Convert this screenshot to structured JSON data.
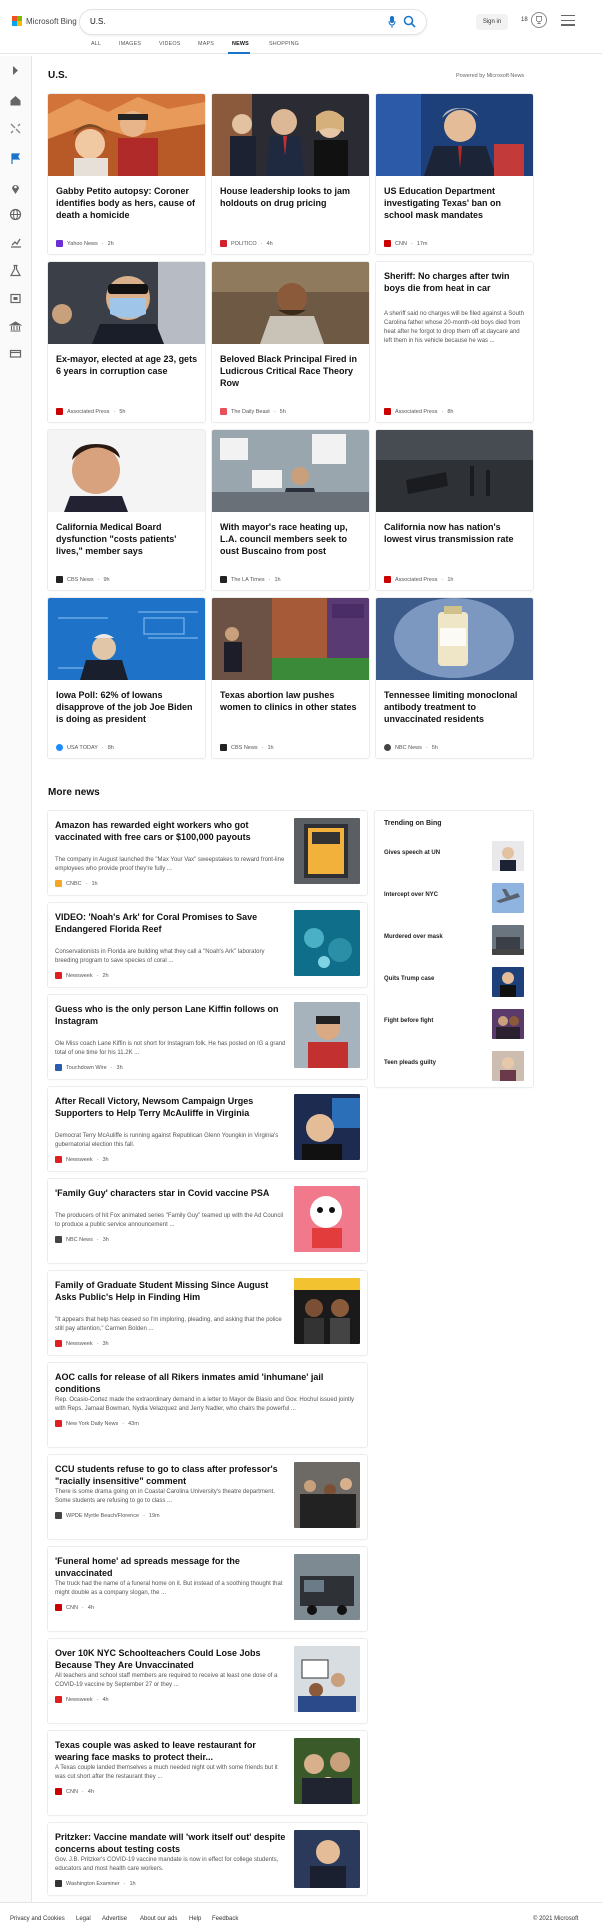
{
  "brand": {
    "name": "Microsoft Bing"
  },
  "search": {
    "query": "U.S."
  },
  "header": {
    "sign_in": "Sign in",
    "points": "18"
  },
  "tabs": [
    "ALL",
    "IMAGES",
    "VIDEOS",
    "MAPS",
    "NEWS",
    "SHOPPING"
  ],
  "active_tab": "NEWS",
  "section": {
    "title": "U.S.",
    "powered_by": "Powered by Microsoft News"
  },
  "cards": [
    {
      "title": "Gabby Petito autopsy: Coroner identifies body as hers, cause of death a homicide",
      "source": "Yahoo News",
      "time": "2h",
      "source_color": "#6b2fd4"
    },
    {
      "title": "House leadership looks to jam holdouts on drug pricing",
      "source": "POLITICO",
      "time": "4h",
      "source_color": "#d3202a"
    },
    {
      "title": "US Education Department investigating Texas' ban on school mask mandates",
      "source": "CNN",
      "time": "17m",
      "source_color": "#cc0000"
    },
    {
      "title": "Ex-mayor, elected at age 23, gets 6 years in corruption case",
      "source": "Associated Press",
      "time": "5h",
      "source_color": "#cc0000"
    },
    {
      "title": "Beloved Black Principal Fired in Ludicrous Critical Race Theory Row",
      "source": "The Daily Beast",
      "time": "5h",
      "source_color": "#e8505b"
    },
    {
      "title": "Sheriff: No charges after twin boys die from heat in car",
      "snippet": "A sheriff said no charges will be filed against a South Carolina father whose 20-month-old boys died from heat after he forgot to drop them off at daycare and left them in his vehicle because he was ...",
      "source": "Associated Press",
      "time": "8h",
      "source_color": "#cc0000"
    },
    {
      "title": "California Medical Board dysfunction \"costs patients' lives,\" member says",
      "source": "CBS News",
      "time": "9h",
      "source_color": "#222222"
    },
    {
      "title": "With mayor's race heating up, L.A. council members seek to oust Buscaino from post",
      "source": "The LA Times",
      "time": "1h",
      "source_color": "#222222"
    },
    {
      "title": "California now has nation's lowest virus transmission rate",
      "source": "Associated Press",
      "time": "1h",
      "source_color": "#cc0000"
    },
    {
      "title": "Iowa Poll: 62% of Iowans disapprove of the job Joe Biden is doing as president",
      "source": "USA TODAY",
      "time": "8h",
      "source_color": "#1a8cff"
    },
    {
      "title": "Texas abortion law pushes women to clinics in other states",
      "source": "CBS News",
      "time": "1h",
      "source_color": "#222222"
    },
    {
      "title": "Tennessee limiting monoclonal antibody treatment to unvaccinated residents",
      "source": "NBC News",
      "time": "5h",
      "source_color": "#444444"
    }
  ],
  "more_news_title": "More news",
  "news": [
    {
      "title": "Amazon has rewarded eight workers who got vaccinated with free cars or $100,000 payouts",
      "snippet": "The company in August launched the \"Max Your Vax\" sweepstakes to reward front-line employees who provide proof they're fully ...",
      "source": "CNBC",
      "time": "1h",
      "source_color": "#f5a623"
    },
    {
      "title": "VIDEO: 'Noah's Ark' for Coral Promises to Save Endangered Florida Reef",
      "snippet": "Conservationists in Florida are building what they call a \"Noah's Ark\" laboratory breeding program to save species of coral ...",
      "source": "Newsweek",
      "time": "2h",
      "source_color": "#e02020"
    },
    {
      "title": "Guess who is the only person Lane Kiffin follows on Instagram",
      "snippet": "Ole Miss coach Lane Kiffin is not short for Instagram folk. He has posted on IG a grand total of one time for his 11.2K ...",
      "source": "Touchdown Wire",
      "time": "3h",
      "source_color": "#2a5db0"
    },
    {
      "title": "After Recall Victory, Newsom Campaign Urges Supporters to Help Terry McAuliffe in Virginia",
      "snippet": "Democrat Terry McAuliffe is running against Republican Glenn Youngkin in Virginia's gubernatorial election this fall.",
      "source": "Newsweek",
      "time": "3h",
      "source_color": "#e02020"
    },
    {
      "title": "'Family Guy' characters star in Covid vaccine PSA",
      "snippet": "The producers of hit Fox animated series \"Family Guy\" teamed up with the Ad Council to produce a public service announcement ...",
      "source": "NBC News",
      "time": "3h",
      "source_color": "#444444"
    },
    {
      "title": "Family of Graduate Student Missing Since August Asks Public's Help in Finding Him",
      "snippet": "\"It appears that help has ceased so I'm imploring, pleading, and asking that the police still pay attention,\" Carmen Bolden ...",
      "source": "Newsweek",
      "time": "3h",
      "source_color": "#e02020"
    },
    {
      "title": "AOC calls for release of all Rikers inmates amid 'inhumane' jail conditions",
      "snippet": "Rep. Ocasio-Cortez made the extraordinary demand in a letter to Mayor de Blasio and Gov. Hochul issued jointly with Reps. Jamaal Bowman, Nydia Velazquez and Jerry Nadler, who chairs the powerful ...",
      "source": "New York Daily News",
      "time": "43m",
      "source_color": "#e02020"
    },
    {
      "title": "CCU students refuse to go to class after professor's \"racially insensitive\" comment",
      "snippet": "There is some drama going on in Coastal Carolina University's theatre department. Some students are refusing to go to class ...",
      "source": "WPDE Myrtle Beach/Florence",
      "time": "19m",
      "source_color": "#444444"
    },
    {
      "title": "'Funeral home' ad spreads message for the unvaccinated",
      "snippet": "The truck had the name of a funeral home on it. But instead of a soothing thought that might double as a company slogan, the ...",
      "source": "CNN",
      "time": "4h",
      "source_color": "#cc0000"
    },
    {
      "title": "Over 10K NYC Schoolteachers Could Lose Jobs Because They Are Unvaccinated",
      "snippet": "All teachers and school staff members are required to receive at least one dose of a COVID-19 vaccine by September 27 or they ...",
      "source": "Newsweek",
      "time": "4h",
      "source_color": "#e02020"
    },
    {
      "title": "Texas couple was asked to leave restaurant for wearing face masks to protect their...",
      "snippet": "A Texas couple landed themselves a much needed night out with some friends but it was cut short after the restaurant they ...",
      "source": "CNN",
      "time": "4h",
      "source_color": "#cc0000"
    },
    {
      "title": "Pritzker: Vaccine mandate will 'work itself out' despite concerns about testing costs",
      "snippet": "Gov. J.B. Pritzker's COVID-19 vaccine mandate is now in effect for college students, educators and most health care workers.",
      "source": "Washington Examiner",
      "time": "1h",
      "source_color": "#333333"
    }
  ],
  "trending": {
    "title": "Trending on Bing",
    "items": [
      "Gives speech at UN",
      "Intercept over NYC",
      "Murdered over mask",
      "Quits Trump case",
      "Fight before fight",
      "Teen pleads guilty"
    ]
  },
  "footer": {
    "links": [
      "Privacy and Cookies",
      "Legal",
      "Advertise",
      "About our ads",
      "Help",
      "Feedback"
    ],
    "copyright": "© 2021 Microsoft"
  }
}
